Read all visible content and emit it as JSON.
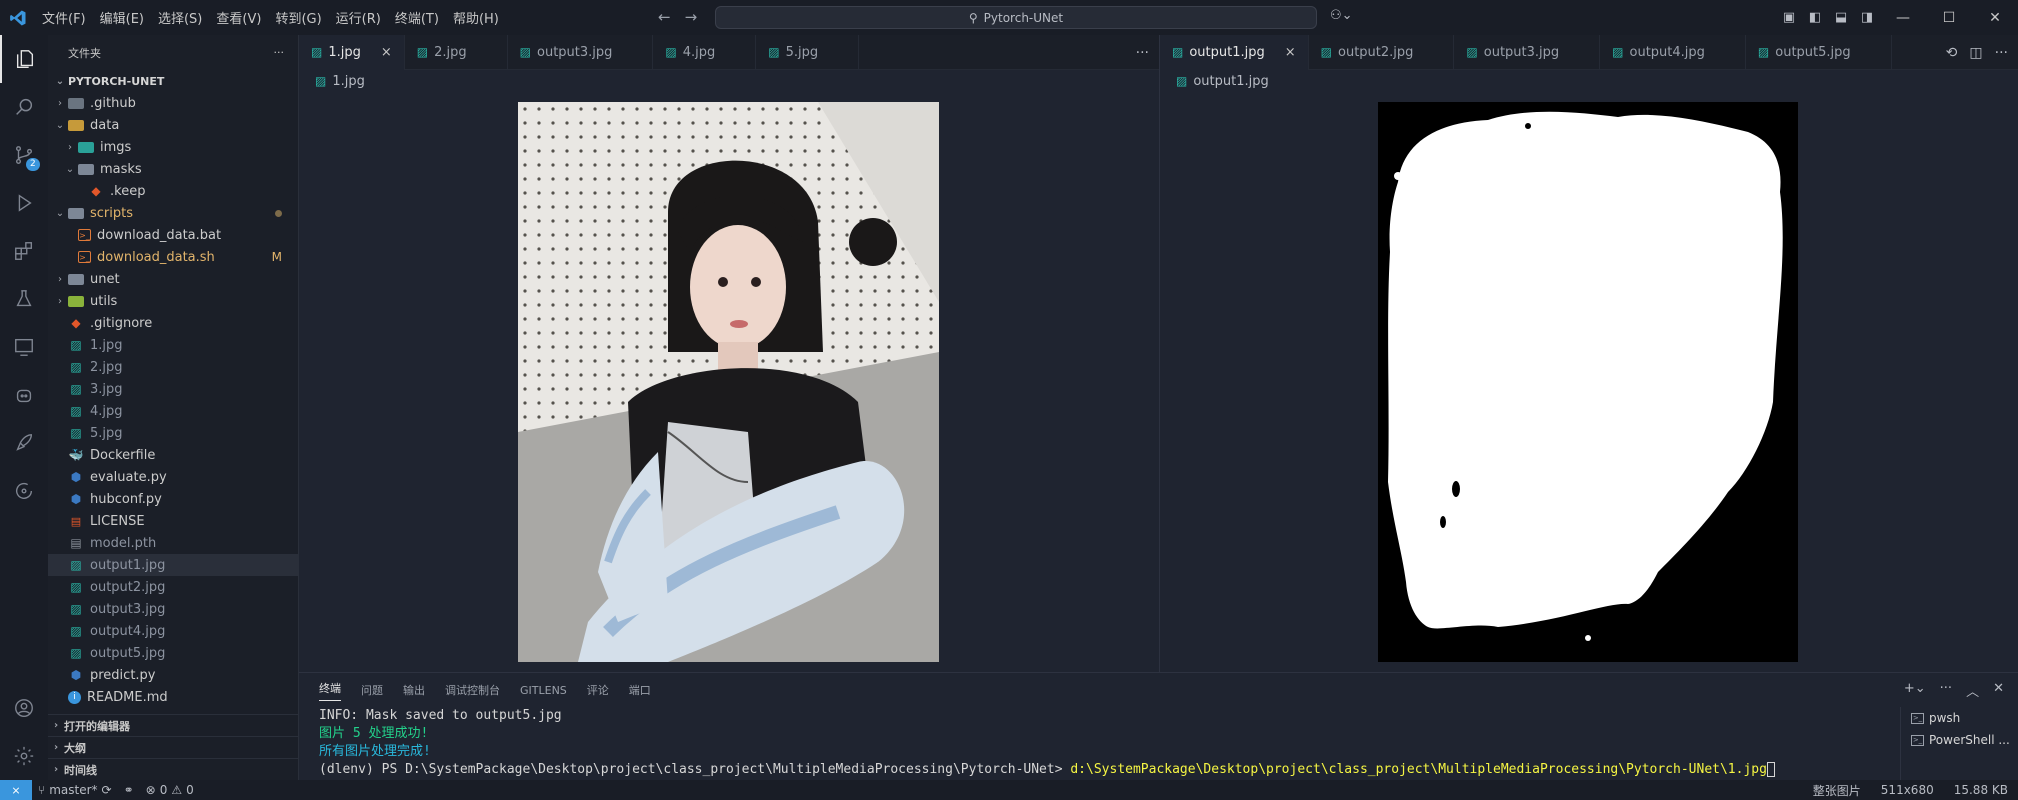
{
  "titlebar": {
    "logo": "VS",
    "menu": [
      "文件(F)",
      "编辑(E)",
      "选择(S)",
      "查看(V)",
      "转到(G)",
      "运行(R)",
      "终端(T)",
      "帮助(H)"
    ],
    "search_text": "Pytorch-UNet"
  },
  "sidebar": {
    "header": "文件夹",
    "project": "PYTORCH-UNET",
    "tree": [
      {
        "name": ".github",
        "kind": "folder-gh",
        "level": 1,
        "chev": "›"
      },
      {
        "name": "data",
        "kind": "folder-data",
        "level": 1,
        "chev": "⌄"
      },
      {
        "name": "imgs",
        "kind": "folder-imgs",
        "level": 2,
        "chev": "›"
      },
      {
        "name": "masks",
        "kind": "folder-masks",
        "level": 2,
        "chev": "⌄"
      },
      {
        "name": ".keep",
        "kind": "git",
        "level": 3,
        "chev": ""
      },
      {
        "name": "scripts",
        "kind": "folder-scripts",
        "level": 1,
        "chev": "⌄",
        "mod": true,
        "dot": true
      },
      {
        "name": "download_data.bat",
        "kind": "sh",
        "level": 2,
        "chev": ""
      },
      {
        "name": "download_data.sh",
        "kind": "sh",
        "level": 2,
        "chev": "",
        "mod": true,
        "flag": "M"
      },
      {
        "name": "unet",
        "kind": "folder-unet",
        "level": 1,
        "chev": "›"
      },
      {
        "name": "utils",
        "kind": "folder-utils",
        "level": 1,
        "chev": "›"
      },
      {
        "name": ".gitignore",
        "kind": "git",
        "level": 1,
        "chev": ""
      },
      {
        "name": "1.jpg",
        "kind": "img",
        "level": 1,
        "chev": "",
        "dim": true
      },
      {
        "name": "2.jpg",
        "kind": "img",
        "level": 1,
        "chev": "",
        "dim": true
      },
      {
        "name": "3.jpg",
        "kind": "img",
        "level": 1,
        "chev": "",
        "dim": true
      },
      {
        "name": "4.jpg",
        "kind": "img",
        "level": 1,
        "chev": "",
        "dim": true
      },
      {
        "name": "5.jpg",
        "kind": "img",
        "level": 1,
        "chev": "",
        "dim": true
      },
      {
        "name": "Dockerfile",
        "kind": "docker",
        "level": 1,
        "chev": ""
      },
      {
        "name": "evaluate.py",
        "kind": "py",
        "level": 1,
        "chev": ""
      },
      {
        "name": "hubconf.py",
        "kind": "py",
        "level": 1,
        "chev": ""
      },
      {
        "name": "LICENSE",
        "kind": "lic",
        "level": 1,
        "chev": ""
      },
      {
        "name": "model.pth",
        "kind": "file",
        "level": 1,
        "chev": "",
        "dim": true
      },
      {
        "name": "output1.jpg",
        "kind": "img",
        "level": 1,
        "chev": "",
        "dim": true,
        "sel": true
      },
      {
        "name": "output2.jpg",
        "kind": "img",
        "level": 1,
        "chev": "",
        "dim": true
      },
      {
        "name": "output3.jpg",
        "kind": "img",
        "level": 1,
        "chev": "",
        "dim": true
      },
      {
        "name": "output4.jpg",
        "kind": "img",
        "level": 1,
        "chev": "",
        "dim": true
      },
      {
        "name": "output5.jpg",
        "kind": "img",
        "level": 1,
        "chev": "",
        "dim": true
      },
      {
        "name": "predict.py",
        "kind": "py",
        "level": 1,
        "chev": ""
      },
      {
        "name": "README.md",
        "kind": "info",
        "level": 1,
        "chev": ""
      }
    ],
    "sections": [
      "打开的编辑器",
      "大纲",
      "时间线"
    ]
  },
  "editor_left": {
    "tabs": [
      {
        "label": "1.jpg",
        "active": true,
        "close": "×"
      },
      {
        "label": "2.jpg"
      },
      {
        "label": "output3.jpg"
      },
      {
        "label": "4.jpg"
      },
      {
        "label": "5.jpg"
      }
    ],
    "breadcrumb": "1.jpg",
    "more": "···"
  },
  "editor_right": {
    "tabs": [
      {
        "label": "output1.jpg",
        "active": true,
        "close": "×"
      },
      {
        "label": "output2.jpg"
      },
      {
        "label": "output3.jpg"
      },
      {
        "label": "output4.jpg"
      },
      {
        "label": "output5.jpg"
      }
    ],
    "breadcrumb": "output1.jpg",
    "more": "···"
  },
  "panel": {
    "tabs": [
      "终端",
      "问题",
      "输出",
      "调试控制台",
      "GITLENS",
      "评论",
      "端口"
    ],
    "lines": [
      {
        "text": "INFO: Mask saved to output5.jpg",
        "color": "white"
      },
      {
        "text": "图片 5 处理成功!",
        "color": "green"
      },
      {
        "text": "所有图片处理完成!",
        "color": "cyan"
      }
    ],
    "prompt": "(dlenv) PS D:\\SystemPackage\\Desktop\\project\\class_project\\MultipleMediaProcessing\\Pytorch-UNet> ",
    "command": "d:\\SystemPackage\\Desktop\\project\\class_project\\MultipleMediaProcessing\\Pytorch-UNet\\1.jpg",
    "terminals": [
      "pwsh",
      "PowerShell ..."
    ]
  },
  "status": {
    "branch": "master*",
    "errors": "0",
    "warnings": "0",
    "right": [
      "整张图片",
      "511x680",
      "15.88 KB"
    ]
  }
}
